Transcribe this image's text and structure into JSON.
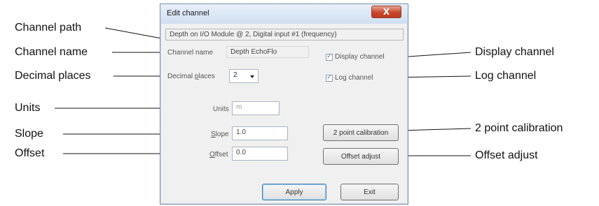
{
  "window": {
    "title": "Edit channel",
    "close_glyph": "X",
    "channel_path": "Depth on I/O Module @ 2, Digital input #1 (frequency)",
    "channel_name_label": "Channel name",
    "channel_name_value": "Depth EchoFlo",
    "display_channel_label": "Display channel",
    "display_channel_checked": true,
    "log_channel_label": "Log channel",
    "log_channel_checked": true,
    "decimal_places": {
      "prefix": "Decimal ",
      "hotkey": "p",
      "suffix": "laces",
      "value": "2"
    },
    "units": {
      "label": "Units",
      "value": "m"
    },
    "slope": {
      "hotkey": "S",
      "rest": "lope",
      "value": "1.0"
    },
    "offset": {
      "hotkey": "O",
      "rest": "ffset",
      "value": "0.0"
    },
    "two_point_calibration_label": "2 point calibration",
    "offset_adjust_label": "Offset adjust",
    "apply_label": "Apply",
    "exit_label": "Exit",
    "check_glyph": "✓"
  },
  "callouts": {
    "channel_path": "Channel path",
    "channel_name": "Channel name",
    "decimal_places": "Decimal places",
    "units": "Units",
    "slope": "Slope",
    "offset": "Offset",
    "display_channel": "Display channel",
    "log_channel": "Log channel",
    "two_point_calibration": "2 point calibration",
    "offset_adjust": "Offset adjust"
  }
}
